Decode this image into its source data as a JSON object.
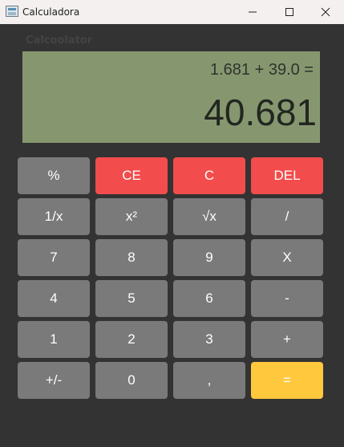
{
  "window": {
    "title": "Calculadora",
    "controls": {
      "minimize": "minimize-icon",
      "maximize": "maximize-icon",
      "close": "close-icon"
    }
  },
  "app": {
    "label": "Calcoolator"
  },
  "display": {
    "expression": "1.681 + 39.0 =",
    "result": "40.681"
  },
  "colors": {
    "background": "#333333",
    "display": "#869770",
    "key": "#7a7a7a",
    "clear_key": "#f24c4c",
    "equals_key": "#ffc83d",
    "titlebar": "#f4f0f0"
  },
  "keys": {
    "percent": "%",
    "clear_entry": "CE",
    "clear": "C",
    "delete": "DEL",
    "reciprocal": "1/x",
    "square": "x²",
    "square_root": "√x",
    "divide": "/",
    "seven": "7",
    "eight": "8",
    "nine": "9",
    "multiply": "X",
    "four": "4",
    "five": "5",
    "six": "6",
    "subtract": "-",
    "one": "1",
    "two": "2",
    "three": "3",
    "add": "+",
    "negate": "+/-",
    "zero": "0",
    "decimal": ",",
    "equals": "="
  }
}
